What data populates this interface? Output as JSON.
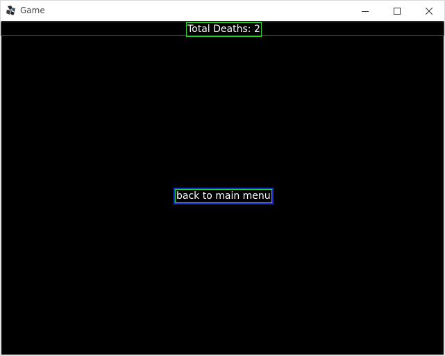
{
  "window": {
    "title": "Game",
    "app_icon": "game-app-icon",
    "controls": {
      "minimize_icon": "minimize-icon",
      "maximize_icon": "maximize-icon",
      "close_icon": "close-icon"
    }
  },
  "hud": {
    "total_deaths_label": "Total Deaths: 2"
  },
  "menu": {
    "back_button_label": "back to main menu"
  },
  "colors": {
    "background": "#000000",
    "text": "#ffffff",
    "hud_border": "#e0202a",
    "label_border": "#2bd12b",
    "button_border": "#1a2fd6"
  }
}
